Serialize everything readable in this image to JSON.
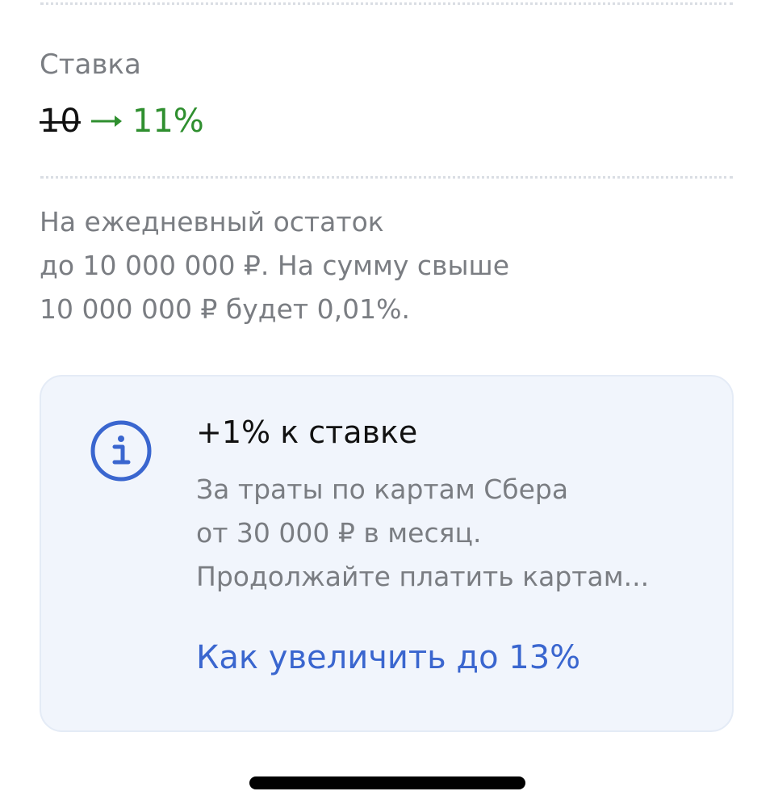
{
  "rate": {
    "label": "Ставка",
    "old_value": "10",
    "new_value": "11%"
  },
  "description": {
    "lines": [
      "На ежедневный остаток",
      "до 10 000 000 ₽. На сумму свыше",
      "10 000 000 ₽ будет 0,01%."
    ]
  },
  "bonus_card": {
    "icon": "info-icon",
    "title": "+1% к ставке",
    "lines": [
      "За траты по картам Сбера",
      "от 30 000 ₽ в месяц.",
      "Продолжайте платить картам..."
    ],
    "link": "Как увеличить до 13%"
  },
  "colors": {
    "accent_green": "#2f8f2f",
    "link_blue": "#3a66cf",
    "card_bg": "#f1f5fc",
    "muted_text": "#7a7d82"
  }
}
